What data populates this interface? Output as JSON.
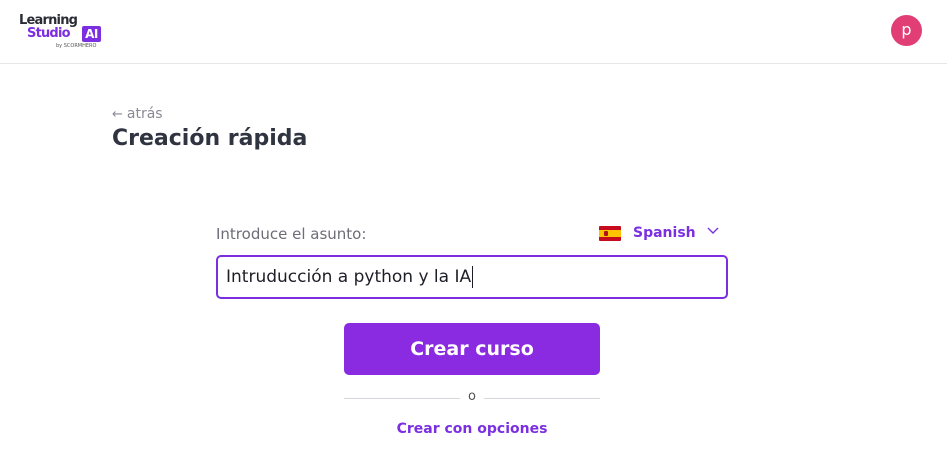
{
  "header": {
    "logo_line1": "Learning",
    "logo_line2": "Studio",
    "logo_ai": "AI",
    "logo_by": "by SCORMHERO",
    "avatar_initial": "p"
  },
  "nav": {
    "back_label": "atrás"
  },
  "page": {
    "title": "Creación rápida"
  },
  "form": {
    "subject_label": "Introduce el asunto:",
    "language": "Spanish",
    "subject_value": "Intruducción a python y la IA",
    "create_button": "Crear curso",
    "divider_text": "o",
    "options_link": "Crear con opciones"
  },
  "colors": {
    "accent": "#8a2be2",
    "avatar": "#e23e76"
  }
}
